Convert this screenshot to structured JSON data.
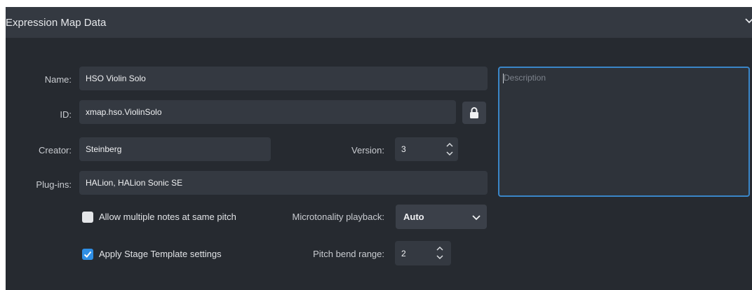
{
  "header": {
    "title": "Expression Map Data"
  },
  "form": {
    "name_label": "Name:",
    "name_value": "HSO Violin Solo",
    "id_label": "ID:",
    "id_value": "xmap.hso.ViolinSolo",
    "creator_label": "Creator:",
    "creator_value": "Steinberg",
    "version_label": "Version:",
    "version_value": "3",
    "plugins_label": "Plug-ins:",
    "plugins_value": "HALion, HALion Sonic SE",
    "description_placeholder": "Description",
    "allow_multiple_label": "Allow multiple notes at same pitch",
    "allow_multiple_checked": false,
    "apply_stage_label": "Apply Stage Template settings",
    "apply_stage_checked": true,
    "microtonality_label": "Microtonality playback:",
    "microtonality_value": "Auto",
    "pitch_bend_label": "Pitch bend range:",
    "pitch_bend_value": "2"
  },
  "colors": {
    "panel_bg": "#262a30",
    "header_bg": "#343941",
    "field_bg": "#343941",
    "accent": "#2f8fe6",
    "focus_border": "#3a86c8"
  },
  "icons": [
    "chevron-down-icon",
    "lock-icon",
    "spin-up-icon",
    "spin-down-icon",
    "checkmark-icon"
  ]
}
